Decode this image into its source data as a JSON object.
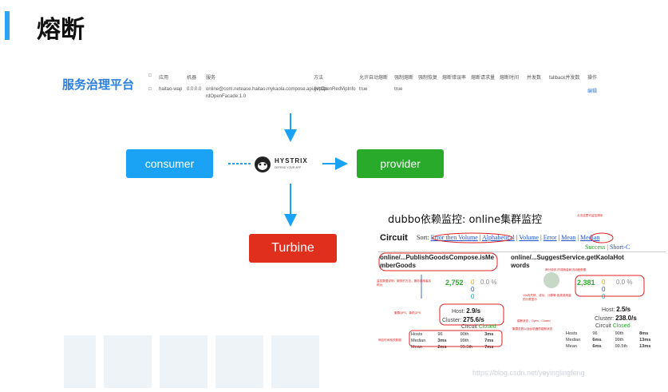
{
  "header": {
    "title": "熔断"
  },
  "platform": {
    "title": "服务治理平台"
  },
  "table": {
    "headers": [
      "应用",
      "机器",
      "服务",
      "方法",
      "允许自动熔断",
      "强制熔断",
      "强制恢复",
      "熔断错误率",
      "熔断请求量",
      "熔断时间",
      "并发数",
      "fallback并发数",
      "操作"
    ],
    "row": {
      "app": "haitao-wap",
      "ip": "0.0.0.0",
      "service_line1": "online@com.netease.haitao.mykaola.compose.api.IVpCo",
      "service_line2": "rdOpenFacade:1.0",
      "method": "getOpenRedVipInfo",
      "auto": "true",
      "force": "true",
      "action": "编辑"
    }
  },
  "boxes": {
    "consumer": "consumer",
    "provider": "provider",
    "turbine": "Turbine"
  },
  "hystrix": {
    "name": "HYSTRIX",
    "tagline": "DEFEND YOUR APP"
  },
  "dashboard": {
    "title": "dubbo依赖监控: online集群监控",
    "circuit_label": "Circuit",
    "sort_label": "Sort:",
    "sort_links": [
      "Error then Volume",
      "Alphabetical",
      "Volume",
      "Error",
      "Mean",
      "Median"
    ],
    "success_label": "Success",
    "short_label": "Short-C",
    "services": [
      {
        "name1": "online/...PublishGoodsCompose.isMe",
        "name2": "mberGoods",
        "total": "2,752",
        "c1": "0",
        "c2": "0",
        "c3": "0",
        "err": "0.0 %",
        "host_label": "Host:",
        "host": "2.9/s",
        "cluster_label": "Cluster:",
        "cluster": "275.6/s",
        "circuit_label": "Circuit",
        "circuit": "Closed",
        "stats": [
          [
            "Hosts",
            "96",
            "90th",
            "3ms"
          ],
          [
            "Median",
            "3ms",
            "99th",
            "7ms"
          ],
          [
            "Mean",
            "2ms",
            "99.5th",
            "7ms"
          ]
        ]
      },
      {
        "name1": "online/...SuggestService.getKaolaHot",
        "name2": "words",
        "total": "2,381",
        "c1": "0",
        "c2": "0",
        "c3": "0",
        "err": "0.0 %",
        "host_label": "Host:",
        "host": "2.5/s",
        "cluster_label": "Cluster:",
        "cluster": "238.0/s",
        "circuit_label": "Circuit",
        "circuit": "Closed",
        "stats": [
          [
            "Hosts",
            "96",
            "90th",
            "8ms"
          ],
          [
            "Median",
            "6ms",
            "99th",
            "13ms"
          ],
          [
            "Mean",
            "6ms",
            "99.5th",
            "13ms"
          ]
        ]
      }
    ],
    "notes": {
      "n1": "点击这里可监控排序",
      "n2": "两分钟内 的调用量和流动趋势图",
      "n3": "监控数据说明：服务的方法，服务调用者名称为",
      "n4": "10s内失败、成功、计算等 各类调用量的分类显示",
      "n5": "集群QPS、单机QPS",
      "n6": "熔断状态，Open、Closed",
      "n7": "集群总数以及台机器的熔断状态",
      "n8": "响应时间相关数据"
    }
  },
  "watermark": "https://blog.csdn.net/yeyinglingfeng",
  "colors": {
    "accent": "#2aa5f5",
    "consumer": "#1aa3f5",
    "provider": "#2aaa2a",
    "turbine": "#e02f1d",
    "note": "#e02020"
  }
}
